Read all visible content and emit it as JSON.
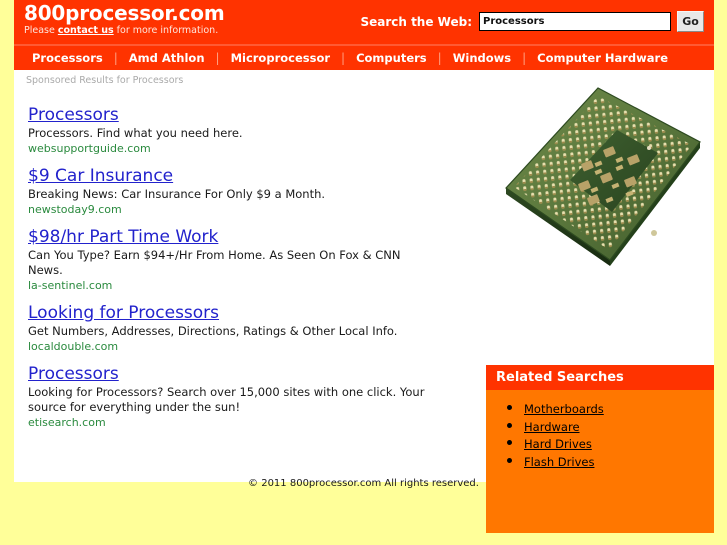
{
  "site": {
    "title": "800processor.com",
    "tagline_before": "Please ",
    "tagline_link": "contact us",
    "tagline_after": " for more information.",
    "brand_red": "#ff3300",
    "brand_orange": "#ff7700",
    "page_background": "#ffff99"
  },
  "search": {
    "label": "Search the Web:",
    "value": "Processors",
    "placeholder": "",
    "button_label": "Go"
  },
  "nav": {
    "items": [
      {
        "label": "Processors"
      },
      {
        "label": "Amd Athlon"
      },
      {
        "label": "Microprocessor"
      },
      {
        "label": "Computers"
      },
      {
        "label": "Windows"
      },
      {
        "label": "Computer Hardware"
      }
    ],
    "separator": "|"
  },
  "main": {
    "sponsored_note": "Sponsored Results for Processors",
    "ads": [
      {
        "title": "Processors",
        "description": "Processors. Find what you need here.",
        "url": "websupportguide.com"
      },
      {
        "title": "$9 Car Insurance",
        "description": "Breaking News: Car Insurance For Only $9 a Month.",
        "url": "newstoday9.com"
      },
      {
        "title": "$98/hr Part Time Work",
        "description": "Can You Type? Earn $94+/Hr From Home. As Seen On Fox & CNN News.",
        "url": "la-sentinel.com"
      },
      {
        "title": "Looking for Processors",
        "description": "Get Numbers, Addresses, Directions, Ratings & Other Local Info.",
        "url": "localdouble.com"
      },
      {
        "title": "Processors",
        "description": "Looking for Processors? Search over 15,000 sites with one click. Your source for everything under the sun!",
        "url": "etisearch.com"
      }
    ]
  },
  "hero": {
    "image_name": "cpu-chip-photo",
    "alt": "Computer processor chip with gold pins"
  },
  "related": {
    "heading": "Related Searches",
    "items": [
      {
        "label": "Motherboards"
      },
      {
        "label": "Hardware"
      },
      {
        "label": "Hard Drives"
      },
      {
        "label": "Flash Drives"
      }
    ]
  },
  "footer": {
    "copyright": "© 2011 800processor.com All rights reserved."
  }
}
